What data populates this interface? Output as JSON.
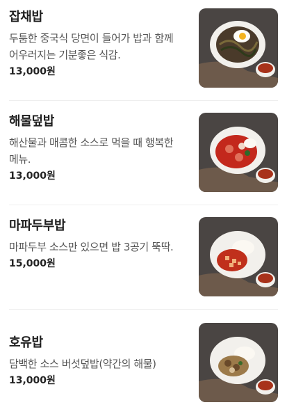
{
  "menu": {
    "items": [
      {
        "name": "잡채밥",
        "description": "두툼한 중국식 당면이 들어가 밥과 함께 어우러지는 기분좋은 식감.",
        "price": "13,000원",
        "photo_icon": "japchae-rice-photo",
        "dish_color": "#3b2f22",
        "garnish_color": "#f3d24c"
      },
      {
        "name": "해물덮밥",
        "description": "해산물과 매콤한 소스로 먹을 때 행복한 메뉴.",
        "price": "13,000원",
        "photo_icon": "seafood-rice-photo",
        "dish_color": "#c3281c",
        "garnish_color": "#f4e6d8"
      },
      {
        "name": "마파두부밥",
        "description": "마파두부 소스만 있으면 밥 3공기 뚝딱.",
        "price": "15,000원",
        "photo_icon": "mapo-tofu-rice-photo",
        "dish_color": "#c0301c",
        "garnish_color": "#f7f1e6"
      },
      {
        "name": "호유밥",
        "description": "담백한 소스 버섯덮밥(약간의 해물)",
        "price": "13,000원",
        "photo_icon": "mushroom-rice-photo",
        "dish_color": "#9c7a4a",
        "garnish_color": "#f7f1e6"
      }
    ]
  }
}
